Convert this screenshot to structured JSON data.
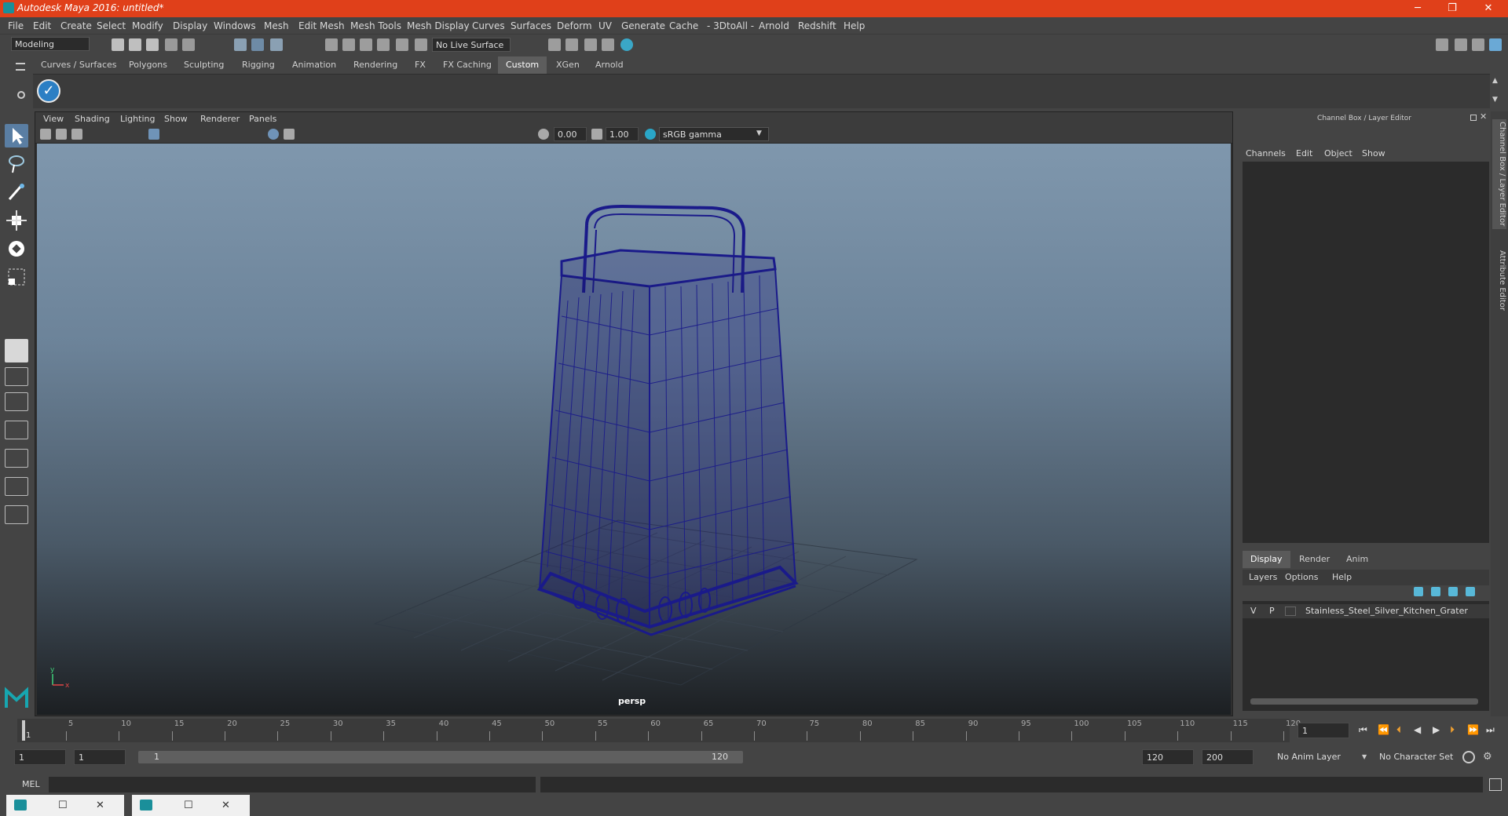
{
  "app": {
    "title": "Autodesk Maya 2016: untitled*",
    "accent": "#e0401a"
  },
  "window_controls": [
    "─",
    "❐",
    "✕"
  ],
  "menubar": [
    "File",
    "Edit",
    "Create",
    "Select",
    "Modify",
    "Display",
    "Windows",
    "Mesh",
    "Edit Mesh",
    "Mesh Tools",
    "Mesh Display",
    "Curves",
    "Surfaces",
    "Deform",
    "UV",
    "Generate",
    "Cache",
    "- 3DtoAll -",
    "Arnold",
    "Redshift",
    "Help"
  ],
  "status": {
    "mode": "Modeling",
    "live_surface": "No Live Surface"
  },
  "shelf_tabs": [
    "Curves / Surfaces",
    "Polygons",
    "Sculpting",
    "Rigging",
    "Animation",
    "Rendering",
    "FX",
    "FX Caching",
    "Custom",
    "XGen",
    "Arnold"
  ],
  "shelf_active": "Custom",
  "viewport": {
    "menu": [
      "View",
      "Shading",
      "Lighting",
      "Show",
      "Renderer",
      "Panels"
    ],
    "exposure": "0.00",
    "gamma": "1.00",
    "color_space": "sRGB gamma",
    "camera": "persp",
    "axis_x": "x",
    "axis_y": "y"
  },
  "channel_box": {
    "title": "Channel Box / Layer Editor",
    "menu": [
      "Channels",
      "Edit",
      "Object",
      "Show"
    ]
  },
  "layer_editor": {
    "tabs": [
      "Display",
      "Render",
      "Anim"
    ],
    "active_tab": "Display",
    "menu": [
      "Layers",
      "Options",
      "Help"
    ],
    "layer": {
      "v": "V",
      "p": "P",
      "name": "Stainless_Steel_Silver_Kitchen_Grater"
    }
  },
  "side_tabs": [
    "Channel Box / Layer Editor",
    "Attribute Editor"
  ],
  "timeline": {
    "ticks": [
      1,
      5,
      10,
      15,
      20,
      25,
      30,
      35,
      40,
      45,
      50,
      55,
      60,
      65,
      70,
      75,
      80,
      85,
      90,
      95,
      100,
      105,
      110,
      115,
      120
    ],
    "current_frame": "1"
  },
  "range": {
    "start": "1",
    "playback_start": "1",
    "slider_start": "1",
    "slider_end": "120",
    "playback_end": "120",
    "end": "200",
    "anim_layer": "No Anim Layer",
    "char_set": "No Character Set"
  },
  "cmdline": {
    "label": "MEL"
  }
}
